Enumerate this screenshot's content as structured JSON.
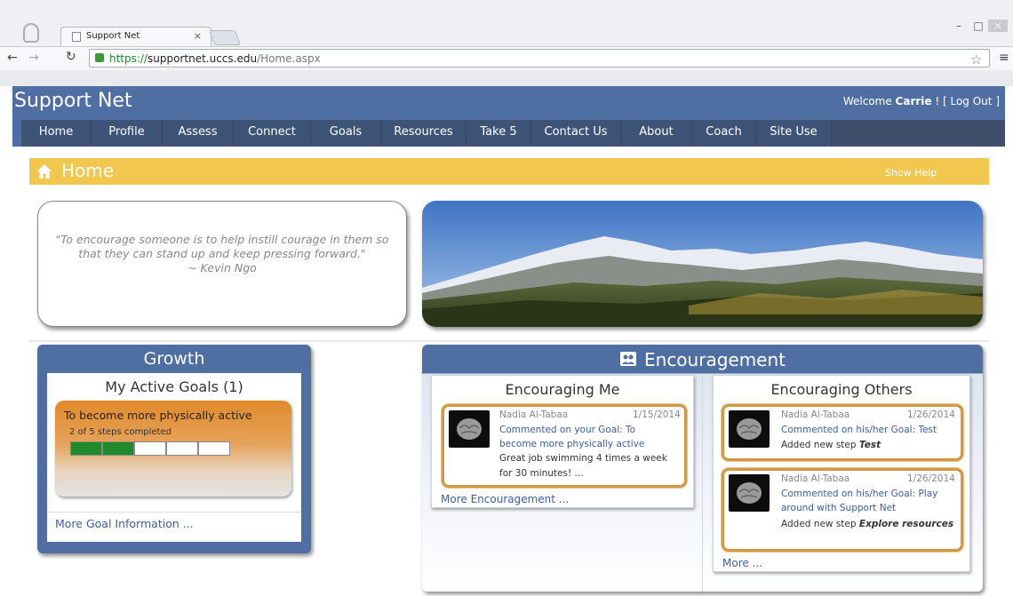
{
  "browser": {
    "tab_title": "Support Net",
    "tab_close": "×",
    "url_scheme": "https://",
    "url_host": "supportnet.uccs.edu",
    "url_path": "/Home.aspx",
    "window_minimize": "–",
    "window_maximize": "□",
    "window_close": "×"
  },
  "site": {
    "name": "Support Net",
    "welcome_prefix": "Welcome ",
    "user_name": "Carrie",
    "welcome_suffix": " ! [ ",
    "logout_label": "Log Out",
    "welcome_end": " ]"
  },
  "nav": {
    "items": [
      "Home",
      "Profile",
      "Assess",
      "Connect",
      "Goals",
      "Resources",
      "Take 5",
      "Contact Us",
      "About",
      "Coach",
      "Site Use"
    ]
  },
  "home_bar": {
    "title": "Home",
    "show_help": "Show Help",
    "color": "#f1c750"
  },
  "quote": {
    "text": "\"To encourage someone is to help instill courage in them so that they can stand up and keep pressing forward.\"",
    "author": "~ Kevin Ngo"
  },
  "growth": {
    "title": "Growth",
    "goals_title": "My Active Goals (1)",
    "goal_name": "To become more physically active",
    "steps_text": "2 of 5 steps completed",
    "steps_completed": 2,
    "steps_total": 5,
    "more_link": "More Goal Information ..."
  },
  "encouragement": {
    "title": "Encouragement",
    "me": {
      "title": "Encouraging Me",
      "more_link": "More Encouragement ...",
      "items": [
        {
          "author": "Nadia Al-Tabaa",
          "date": "1/15/2014",
          "link": "Commented on your Goal: To become more physically active",
          "text": "Great job swimming 4 times a week for 30 minutes! ..."
        }
      ]
    },
    "others": {
      "title": "Encouraging Others",
      "more_link": "More ...",
      "items": [
        {
          "author": "Nadia Al-Tabaa",
          "date": "1/26/2014",
          "link": "Commented on his/her Goal: Test",
          "text_prefix": "Added new step ",
          "text_step": "Test"
        },
        {
          "author": "Nadia Al-Tabaa",
          "date": "1/26/2014",
          "link": "Commented on his/her Goal: Play around with Support Net",
          "text_prefix": "Added new step ",
          "text_step": "Explore resources"
        }
      ]
    }
  },
  "colors": {
    "brand_blue": "#4f6fa3",
    "nav_dark": "#3e5477",
    "goal_orange": "#e08a2a",
    "progress_green": "#1e8a2a",
    "card_border": "#d39844",
    "link_blue": "#3d5d9a"
  }
}
